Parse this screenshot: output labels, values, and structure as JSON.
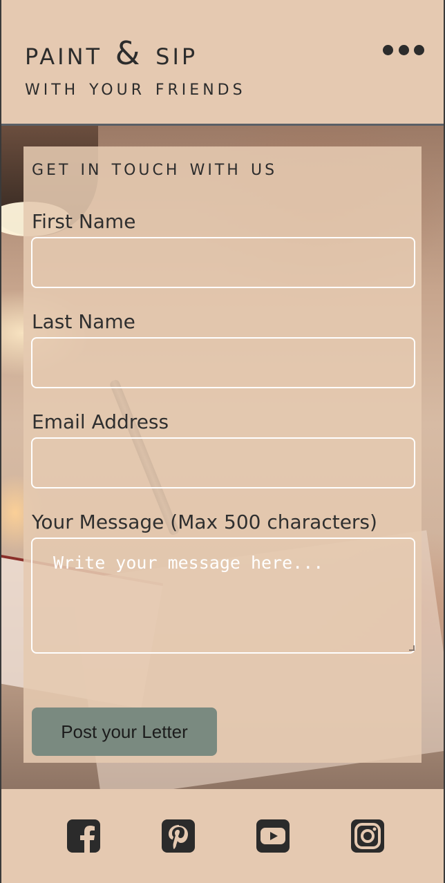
{
  "header": {
    "title": "Paint & Sip",
    "subtitle": "with your Friends",
    "menu_icon": "more-dots-icon"
  },
  "contact": {
    "heading": "Get in touch with us",
    "fields": {
      "first_name": {
        "label": "First Name",
        "value": ""
      },
      "last_name": {
        "label": "Last Name",
        "value": ""
      },
      "email": {
        "label": "Email Address",
        "value": ""
      },
      "message": {
        "label": "Your Message (Max 500 characters)",
        "placeholder": "Write your message here...",
        "value": ""
      }
    },
    "submit_label": "Post your Letter"
  },
  "footer": {
    "social": [
      {
        "name": "facebook-icon"
      },
      {
        "name": "pinterest-icon"
      },
      {
        "name": "youtube-icon"
      },
      {
        "name": "instagram-icon"
      }
    ]
  },
  "colors": {
    "background": "#e5c9b1",
    "text": "#2c2c2c",
    "button": "#7a8a80",
    "input_border": "#ffffff"
  }
}
